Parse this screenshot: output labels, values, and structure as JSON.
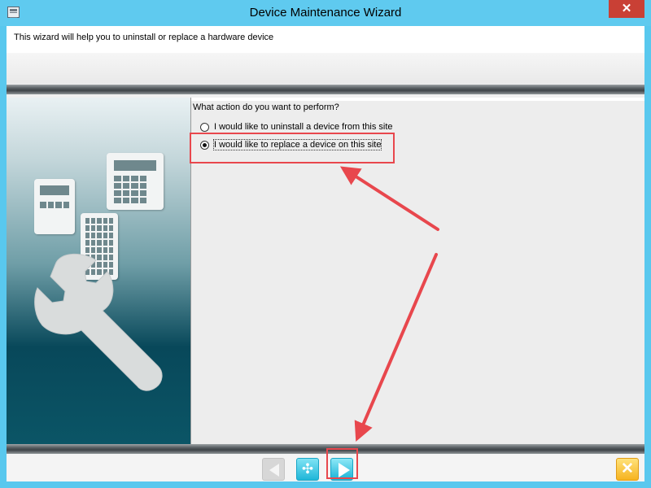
{
  "window": {
    "title": "Device Maintenance Wizard",
    "close_label": "✕"
  },
  "header": {
    "description": "This wizard will help you to uninstall or replace a hardware device"
  },
  "content": {
    "question": "What action do you want to perform?",
    "options": [
      {
        "label": "I would like to uninstall a device from this site",
        "selected": false
      },
      {
        "label": "I would like to replace a device on this site",
        "selected": true
      }
    ]
  },
  "nav": {
    "back_icon": "left-triangle-icon",
    "refresh_icon": "refresh-icon",
    "refresh_symbol": "✣",
    "next_icon": "right-triangle-icon",
    "cancel_icon": "x-icon",
    "cancel_symbol": "✕"
  },
  "illustration": {
    "icons": [
      "calculator-icon",
      "calculator-icon",
      "calculator-icon",
      "wrench-icon"
    ]
  },
  "colors": {
    "title_bar": "#5fcaef",
    "accent_cyan": "#1ab3d6",
    "annotation_red": "#e8474d",
    "cancel_yellow": "#f6b320",
    "panel_teal": "#08485a"
  }
}
